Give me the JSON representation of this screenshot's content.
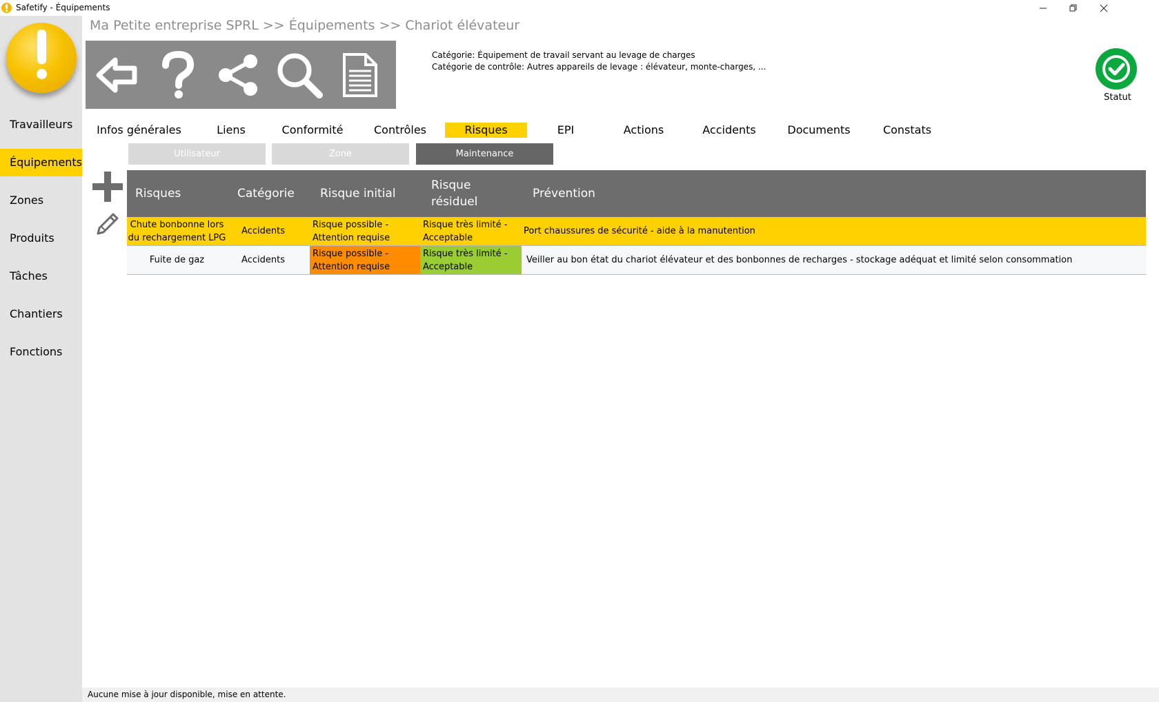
{
  "window": {
    "title": "Safetify - Équipements"
  },
  "breadcrumb": "Ma Petite entreprise SPRL >> Équipements >> Chariot élévateur",
  "sidebar": {
    "items": [
      {
        "label": "Travailleurs",
        "active": false
      },
      {
        "label": "Équipements",
        "active": true
      },
      {
        "label": "Zones",
        "active": false
      },
      {
        "label": "Produits",
        "active": false
      },
      {
        "label": "Tâches",
        "active": false
      },
      {
        "label": "Chantiers",
        "active": false
      },
      {
        "label": "Fonctions",
        "active": false
      }
    ]
  },
  "toolbar": {
    "icons": [
      "back-arrow-icon",
      "help-icon",
      "share-icon",
      "search-icon",
      "document-icon"
    ]
  },
  "info": {
    "categorie": "Catégorie: Équipement de travail servant au levage de charges",
    "categorie_controle": "Catégorie de contrôle:  Autres appareils de levage : élévateur, monte-charges, ..."
  },
  "status": {
    "label": "Statut",
    "color": "#0aa83f"
  },
  "tabs": [
    {
      "label": "Infos générales"
    },
    {
      "label": "Liens"
    },
    {
      "label": "Conformité"
    },
    {
      "label": "Contrôles"
    },
    {
      "label": "Risques",
      "active": true
    },
    {
      "label": "EPI"
    },
    {
      "label": "Actions"
    },
    {
      "label": "Accidents"
    },
    {
      "label": "Documents"
    },
    {
      "label": "Constats"
    }
  ],
  "subtabs": [
    {
      "label": "Utilisateur"
    },
    {
      "label": "Zone"
    },
    {
      "label": "Maintenance",
      "active": true
    }
  ],
  "table": {
    "headers": {
      "risques": "Risques",
      "categorie": "Catégorie",
      "risque_initial": "Risque initial",
      "risque_residuel_1": "Risque",
      "risque_residuel_2": "résiduel",
      "prevention": "Prévention"
    },
    "rows": [
      {
        "name_1": "Chute bonbonne lors",
        "name_2": "du rechargement LPG",
        "categorie": "Accidents",
        "initial_1": "Risque possible -",
        "initial_2": "Attention requise",
        "residuel_1": "Risque très limité -",
        "residuel_2": "Acceptable",
        "prevention": "Port chaussures de sécurité - aide à la manutention"
      },
      {
        "name_1": "Fuite de gaz",
        "name_2": "",
        "categorie": "Accidents",
        "initial_1": "Risque possible -",
        "initial_2": "Attention requise",
        "residuel_1": "Risque très limité -",
        "residuel_2": "Acceptable",
        "prevention": "Veiller au bon état du chariot élévateur et  des bonbonnes de recharges - stockage adéquat et limité selon consommation"
      }
    ]
  },
  "footer": {
    "status_text": "Aucune mise à jour disponible, mise en attente."
  },
  "colors": {
    "accent": "#ffd100",
    "orange": "#ff8c00",
    "green": "#9acd32",
    "header": "#6d6d6d"
  }
}
